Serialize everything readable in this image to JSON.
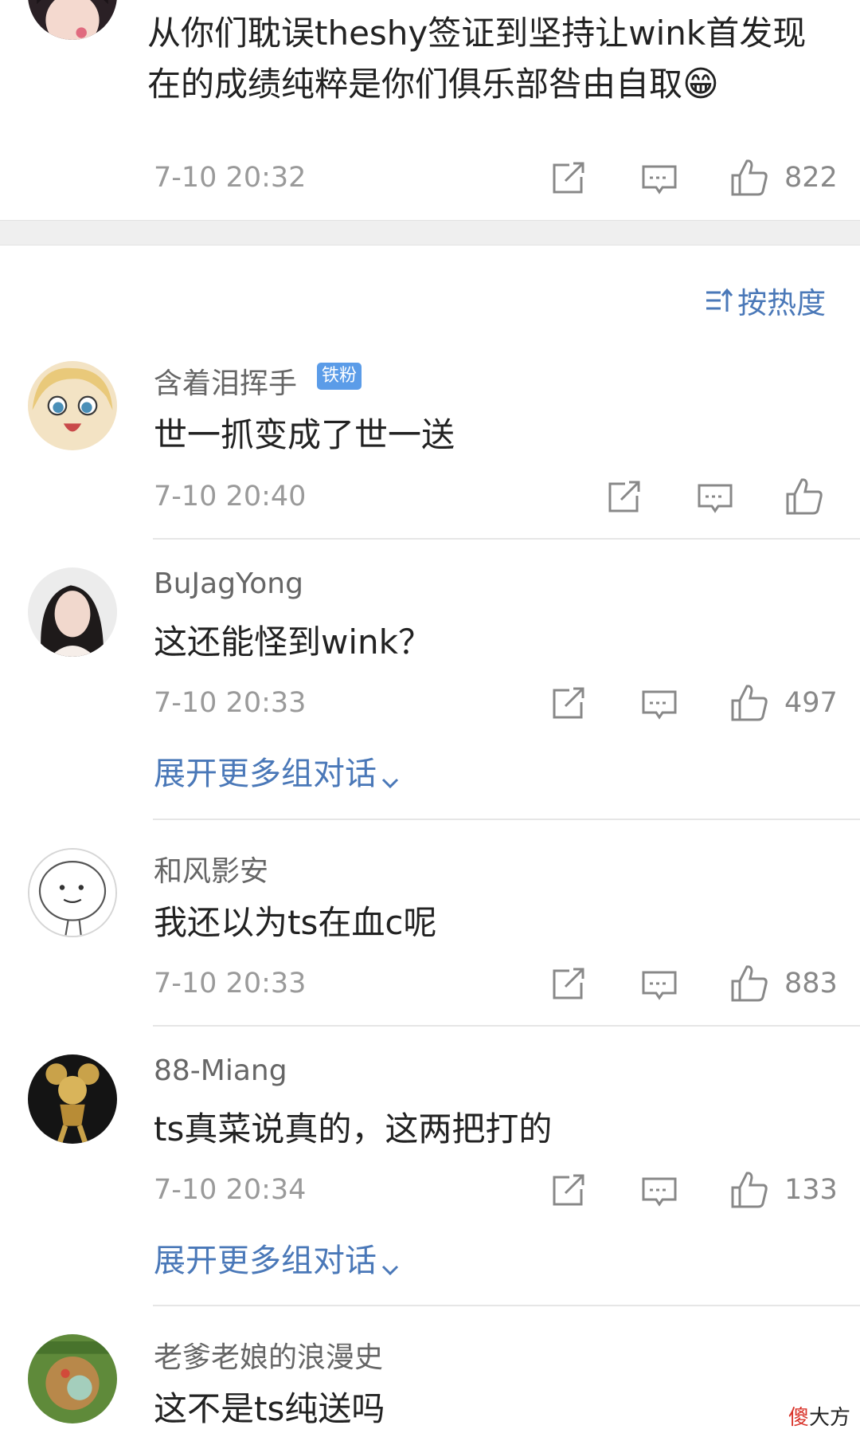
{
  "top_comment": {
    "text_line1": "从你们耽误theshy签证到坚持让wink首发现",
    "text_line2": "在的成绩纯粹是你们俱乐部咎由自取",
    "emoji": "😁",
    "time": "7-10 20:32",
    "likes": "822"
  },
  "sort": {
    "label": "按热度"
  },
  "comments": [
    {
      "username": "含着泪挥手",
      "badge": "铁粉",
      "text": "世一抓变成了世一送",
      "time": "7-10 20:40",
      "likes": ""
    },
    {
      "username": "BuJagYong",
      "text": "这还能怪到wink？",
      "time": "7-10 20:33",
      "likes": "497",
      "more_label": "展开更多组对话"
    },
    {
      "username": "和风影安",
      "text": "我还以为ts在血c呢",
      "time": "7-10 20:33",
      "likes": "883"
    },
    {
      "username": "88-Miang",
      "text": "ts真菜说真的，这两把打的",
      "time": "7-10 20:34",
      "likes": "133",
      "more_label": "展开更多组对话"
    },
    {
      "username": "老爹老娘的浪漫史",
      "text": "这不是ts纯送吗"
    }
  ],
  "watermark": {
    "red_char": "傻",
    "text": "大方"
  },
  "colors": {
    "link_blue": "#4a78b8",
    "badge_blue": "#5b9ce8",
    "timestamp_gray": "#9a9a9a",
    "separator_gray": "#efefef"
  }
}
